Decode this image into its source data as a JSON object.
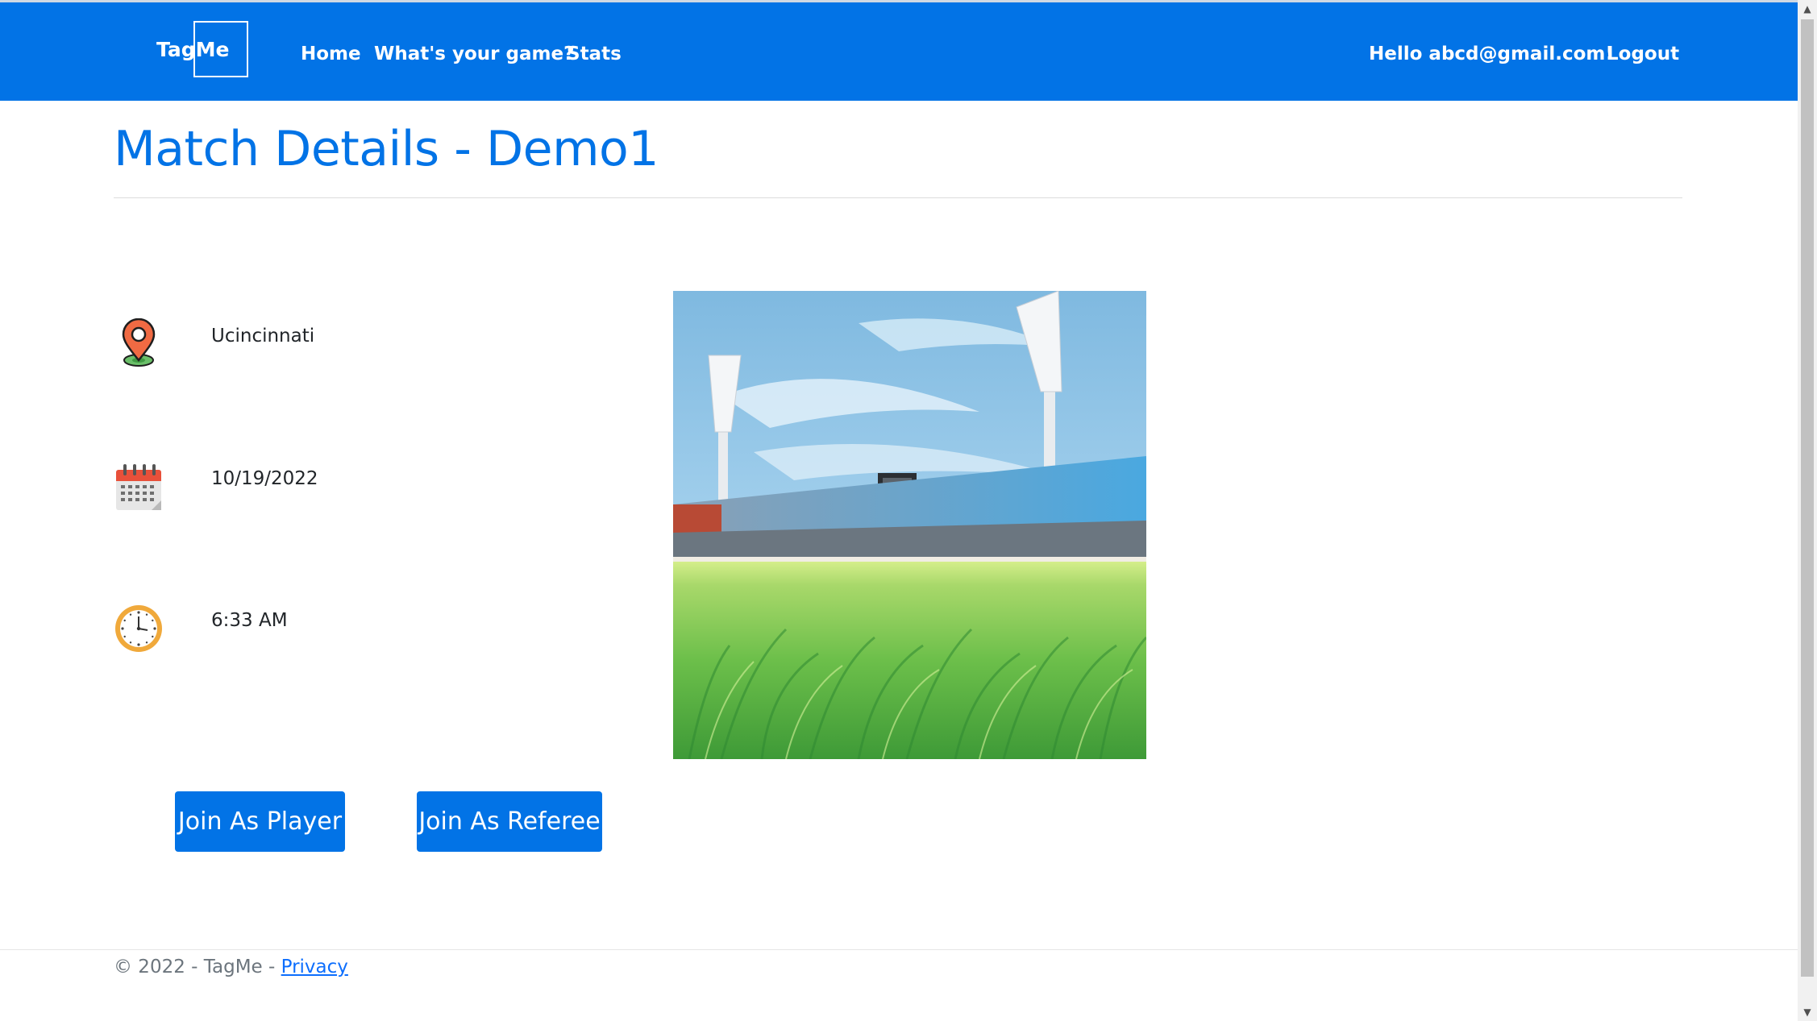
{
  "navbar": {
    "brand": "TagMe",
    "links": {
      "home": "Home",
      "game": "What's your game?",
      "stats": "Stats"
    },
    "greeting": "Hello abcd@gmail.com!",
    "logout": "Logout",
    "background_color": "#0273e6"
  },
  "page": {
    "title": "Match Details - Demo1",
    "title_color": "#0273e6"
  },
  "details": {
    "location": "Ucincinnati",
    "date": "10/19/2022",
    "time": "6:33 AM"
  },
  "icons": {
    "location": "map-pin-icon",
    "date": "calendar-icon",
    "time": "clock-icon"
  },
  "buttons": {
    "join_player": "Join As Player",
    "join_referee": "Join As Referee",
    "color": "#0273e6"
  },
  "footer": {
    "copyright": "© 2022 - TagMe - ",
    "privacy": "Privacy"
  }
}
